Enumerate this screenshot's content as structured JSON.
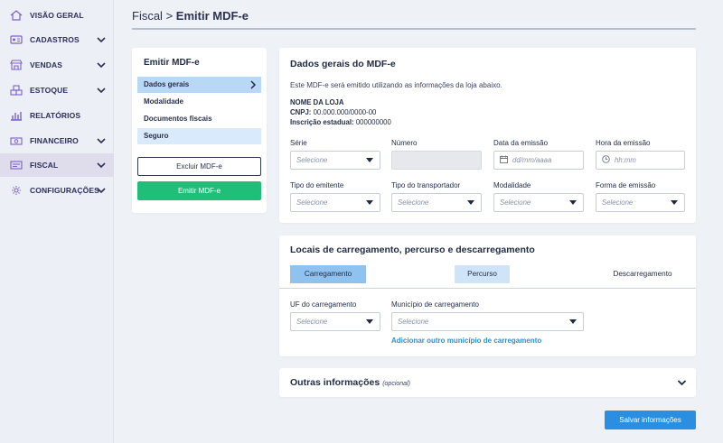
{
  "sidebar": {
    "items": [
      {
        "label": "VISÃO GERAL",
        "icon": "home-icon"
      },
      {
        "label": "CADASTROS",
        "icon": "id-card-icon"
      },
      {
        "label": "VENDAS",
        "icon": "store-icon"
      },
      {
        "label": "ESTOQUE",
        "icon": "boxes-icon"
      },
      {
        "label": "RELATÓRIOS",
        "icon": "bar-chart-icon"
      },
      {
        "label": "FINANCEIRO",
        "icon": "money-icon"
      },
      {
        "label": "FISCAL",
        "icon": "receipt-icon"
      },
      {
        "label": "CONFIGURAÇÕES",
        "icon": "gear-icon"
      }
    ],
    "active": "FISCAL"
  },
  "header": {
    "crumb": "Fiscal",
    "separator": ">",
    "current": "Emitir MDF-e"
  },
  "menu": {
    "title": "Emitir MDF-e",
    "items": [
      "Dados gerais",
      "Modalidade",
      "Documentos fiscais",
      "Seguro"
    ],
    "exclude_label": "Excluir MDF-e",
    "emit_label": "Emitir MDF-e"
  },
  "dados": {
    "title": "Dados gerais do MDF-e",
    "description": "Este MDF-e será emitido utilizando as informações da loja abaixo.",
    "store_name": "NOME DA LOJA",
    "cnpj_label": "CNPJ:",
    "cnpj_value": "00.000.000/0000-00",
    "ie_label": "Inscrição estadual:",
    "ie_value": "000000000",
    "serie_label": "Série",
    "serie_value": "Selecione",
    "numero_label": "Número",
    "data_label": "Data da emissão",
    "data_placeholder": "dd/mm/aaaa",
    "hora_label": "Hora da emissão",
    "hora_placeholder": "hh:mm",
    "tipo_emitente_label": "Tipo do emitente",
    "tipo_emitente_value": "Selecione",
    "tipo_transportador_label": "Tipo do transportador",
    "tipo_transportador_value": "Selecione",
    "modalidade_label": "Modalidade",
    "modalidade_value": "Selecione",
    "forma_label": "Forma de emissão",
    "forma_value": "Selecione"
  },
  "locais": {
    "title": "Locais de carregamento, percurso e descarregamento",
    "tabs": [
      "Carregamento",
      "Percurso",
      "Descarregamento"
    ],
    "uf_label": "UF do carregamento",
    "uf_value": "Selecione",
    "municipio_label": "Município de carregamento",
    "municipio_value": "Selecione",
    "add_link": "Adicionar outro município de carregamento"
  },
  "outras": {
    "title": "Outras informações",
    "optional": "(opcional)"
  },
  "save_label": "Salvar informações",
  "colors": {
    "primary": "#2a8fe0",
    "green": "#1fbf7a",
    "tab_active": "#8fc2ef",
    "sidebar_active": "#dfdcec"
  }
}
